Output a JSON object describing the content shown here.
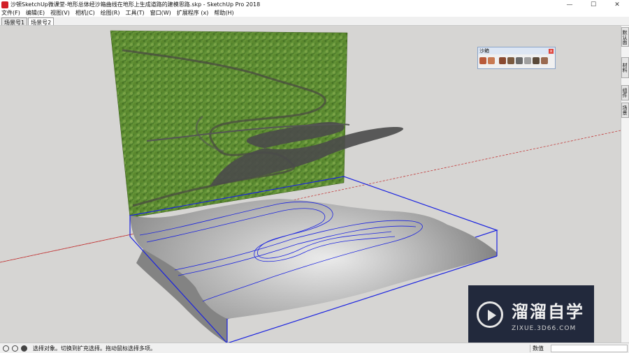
{
  "window": {
    "title": "沙顿SketchUp微课堂-地形总体经沙箱曲线在地形上生成道路的建模思路.skp - SketchUp Pro 2018",
    "minimize_glyph": "—",
    "maximize_glyph": "☐",
    "close_glyph": "✕"
  },
  "menu": {
    "items": [
      "文件(F)",
      "编辑(E)",
      "视图(V)",
      "相机(C)",
      "绘图(R)",
      "工具(T)",
      "窗口(W)",
      "扩展程序 (x)",
      "帮助(H)"
    ]
  },
  "scenes": {
    "tabs": [
      "场景号1",
      "场景号2"
    ],
    "active_index": 1
  },
  "sandbox_toolbar": {
    "title": "沙箱",
    "close_glyph": "x",
    "tools": [
      {
        "icon": "from-contours-icon",
        "color": "#b85a3a"
      },
      {
        "icon": "from-scratch-icon",
        "color": "#c87a52"
      },
      {
        "icon": "smoove-icon",
        "color": "#8a4a30"
      },
      {
        "icon": "stamp-icon",
        "color": "#7a5a40"
      },
      {
        "icon": "drape-icon",
        "color": "#6a6a6a"
      },
      {
        "icon": "add-detail-icon",
        "color": "#a0a0a0"
      },
      {
        "icon": "flip-edge-icon",
        "color": "#5a4a3a"
      },
      {
        "icon": "terrain-icon",
        "color": "#9a6a50"
      }
    ]
  },
  "right_tray": {
    "tabs": [
      "默认面板",
      "材料",
      "组件",
      "场景"
    ]
  },
  "watermark": {
    "name": "溜溜自学",
    "url": "ZIXUE.3D66.COM"
  },
  "status": {
    "message": "选择对象。切换到扩充选择。拖动鼠标选择多项。",
    "measurements_label": "数值",
    "measurements_value": ""
  },
  "colors": {
    "viewport_bg": "#d6d5d3",
    "selection_blue": "#1a22e0",
    "axis_red": "#c23a3a",
    "terrain_gray": "#b8b8b8"
  }
}
